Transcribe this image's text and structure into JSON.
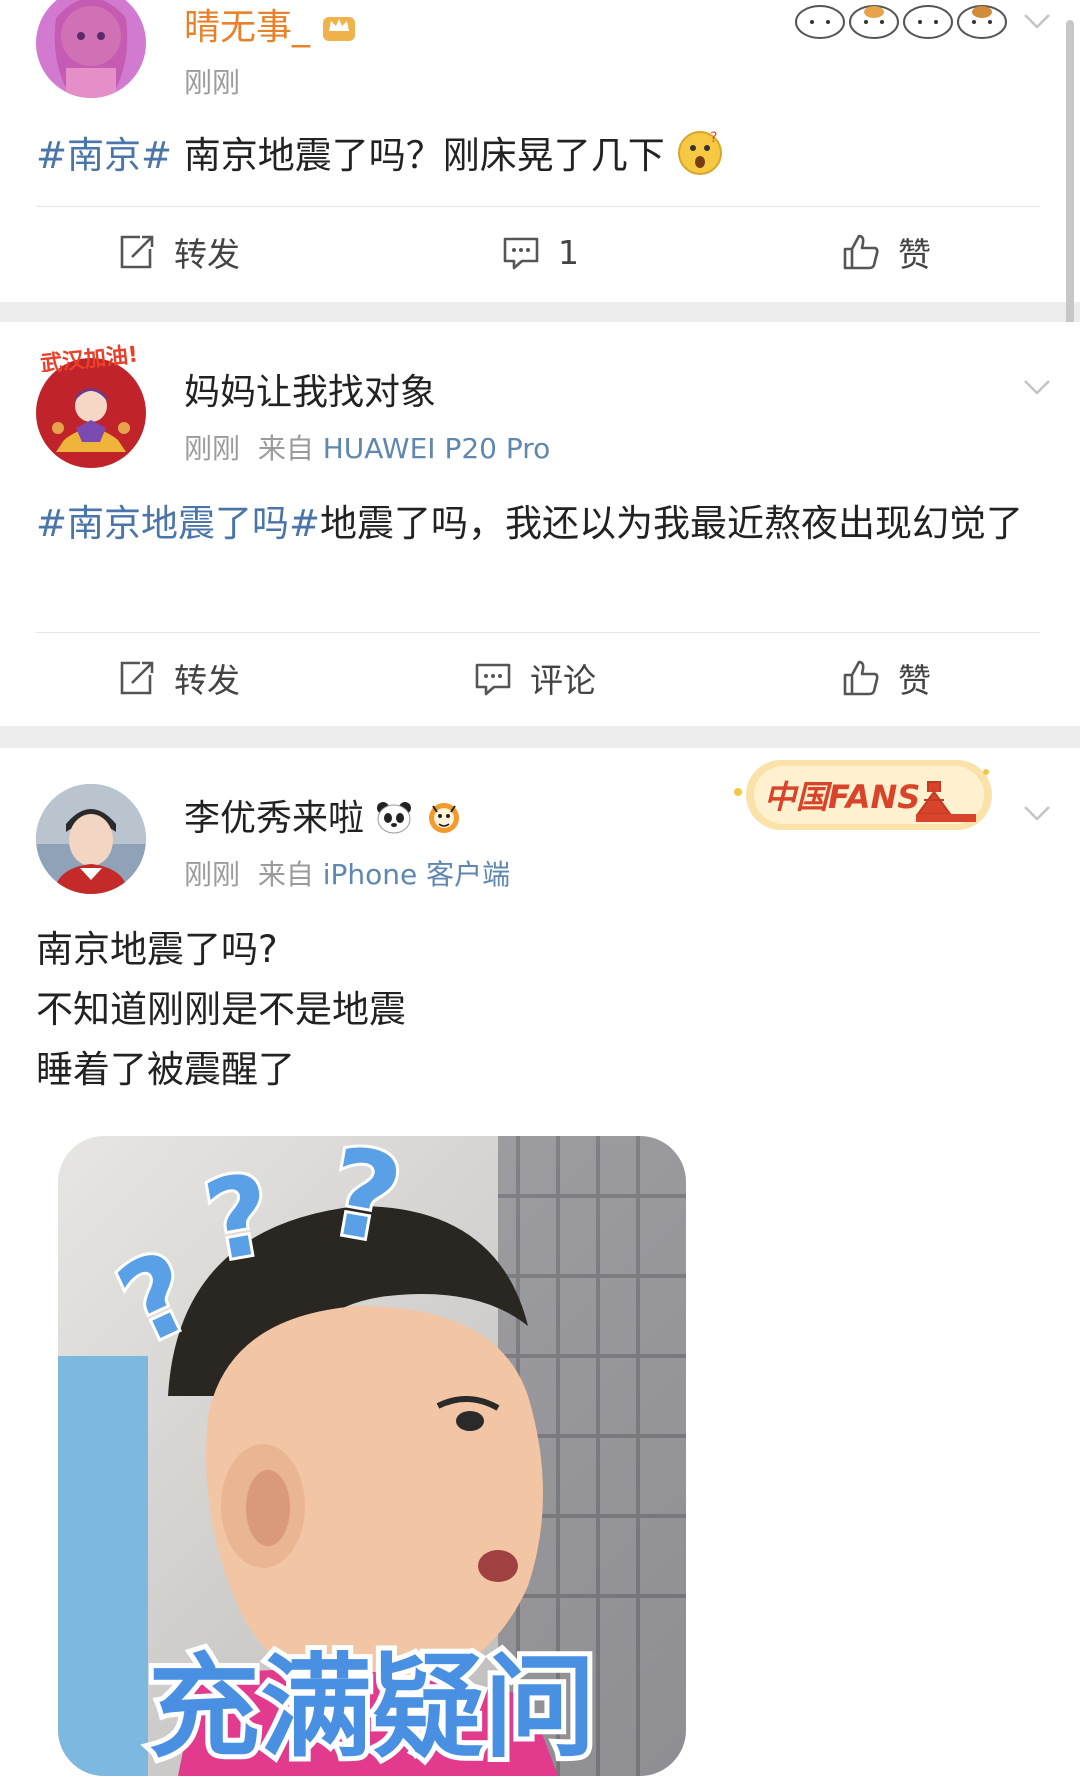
{
  "posts": [
    {
      "username": "晴无事_",
      "time": "刚刚",
      "source_prefix": "",
      "source": "",
      "topic": "#南京#",
      "text": " 南京地震了吗？刚床晃了几下",
      "actions": {
        "repost": "转发",
        "comment": "1",
        "like": "赞"
      }
    },
    {
      "username": "妈妈让我找对象",
      "time": "刚刚",
      "source_prefix": "来自",
      "source": "HUAWEI P20 Pro",
      "topic": "#南京地震了吗#",
      "text": "地震了吗，我还以为我最近熬夜出现幻觉了",
      "actions": {
        "repost": "转发",
        "comment": "评论",
        "like": "赞"
      }
    },
    {
      "username": "李优秀来啦",
      "time": "刚刚",
      "source_prefix": "来自",
      "source": "iPhone 客户端",
      "lines": [
        "南京地震了吗?",
        "不知道刚刚是不是地震",
        "睡着了被震醒了"
      ],
      "image_caption": "充满疑问",
      "badge_text": "中国FANS"
    }
  ],
  "avatar_badge_text": "武汉加油!",
  "colors": {
    "orange_name": "#e8812a",
    "topic_blue": "#4a75a8",
    "meta_gray": "#9b9b9b",
    "separator": "#ededed"
  },
  "icons": [
    "vip-crown-icon",
    "cat-stickers-icon",
    "chevron-down-icon",
    "repost-icon",
    "comment-icon",
    "like-icon",
    "surprised-emoji-icon",
    "panda-icon",
    "tiger-icon"
  ]
}
